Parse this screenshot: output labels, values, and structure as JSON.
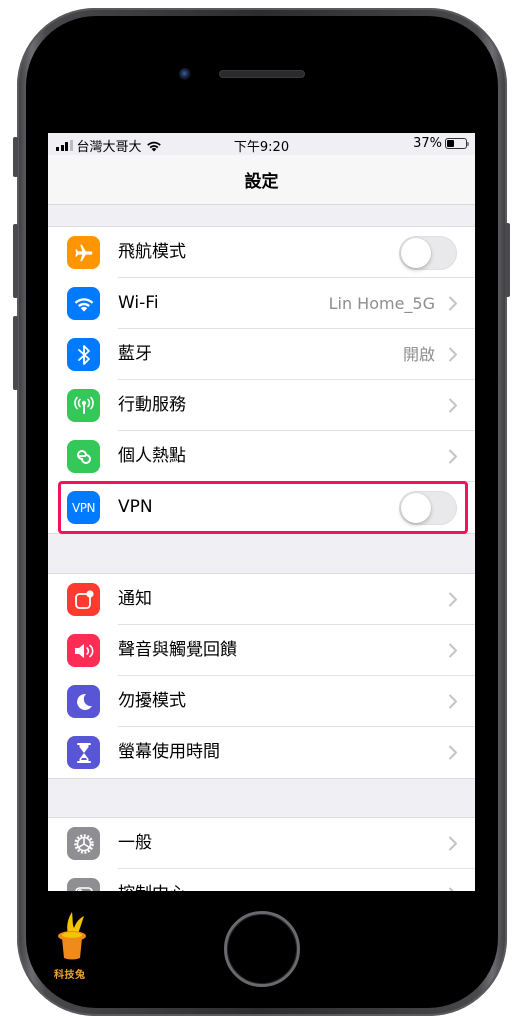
{
  "status_bar": {
    "carrier": "台灣大哥大",
    "time": "下午9:20",
    "battery_percent": "37%",
    "battery_level": 0.37,
    "signal_bars_active": 3,
    "signal_bars_total": 4
  },
  "nav": {
    "title": "設定"
  },
  "sections": [
    {
      "rows": [
        {
          "label": "飛航模式",
          "icon": "airplane-icon",
          "icon_color": "#ff9500",
          "control": "toggle",
          "toggle_on": false
        },
        {
          "label": "Wi-Fi",
          "icon": "wifi-icon",
          "icon_color": "#007aff",
          "control": "chevron",
          "value": "Lin Home_5G"
        },
        {
          "label": "藍牙",
          "icon": "bluetooth-icon",
          "icon_color": "#007aff",
          "control": "chevron",
          "value": "開啟"
        },
        {
          "label": "行動服務",
          "icon": "cellular-icon",
          "icon_color": "#34c759",
          "control": "chevron"
        },
        {
          "label": "個人熱點",
          "icon": "hotspot-icon",
          "icon_color": "#34c759",
          "control": "chevron"
        },
        {
          "label": "VPN",
          "icon": "vpn-icon",
          "icon_text": "VPN",
          "icon_color": "#007aff",
          "control": "toggle",
          "toggle_on": false,
          "highlighted": true
        }
      ]
    },
    {
      "rows": [
        {
          "label": "通知",
          "icon": "notifications-icon",
          "icon_color": "#ff3b30",
          "control": "chevron"
        },
        {
          "label": "聲音與觸覺回饋",
          "icon": "sound-icon",
          "icon_color": "#ff2d55",
          "control": "chevron"
        },
        {
          "label": "勿擾模式",
          "icon": "moon-icon",
          "icon_color": "#5856d6",
          "control": "chevron"
        },
        {
          "label": "螢幕使用時間",
          "icon": "hourglass-icon",
          "icon_color": "#5856d6",
          "control": "chevron"
        }
      ]
    },
    {
      "rows": [
        {
          "label": "一般",
          "icon": "gear-icon",
          "icon_color": "#8e8e93",
          "control": "chevron"
        },
        {
          "label": "控制中心",
          "icon": "control-center-icon",
          "icon_color": "#8e8e93",
          "control": "chevron"
        }
      ]
    }
  ],
  "highlight_color": "#f0145a",
  "watermark": {
    "label": "科技兔"
  }
}
